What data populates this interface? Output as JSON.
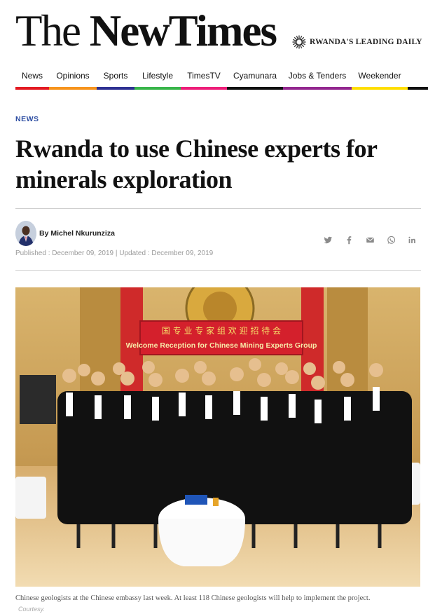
{
  "masthead": {
    "logo_word1": "The",
    "logo_word2": "New",
    "logo_word3": "Times",
    "tagline": "RWANDA'S LEADING DAILY"
  },
  "nav": {
    "items": [
      {
        "label": "News",
        "color": "#e31b23"
      },
      {
        "label": "Opinions",
        "color": "#f7941d"
      },
      {
        "label": "Sports",
        "color": "#2e3192"
      },
      {
        "label": "Lifestyle",
        "color": "#39b54a"
      },
      {
        "label": "TimesTV",
        "color": "#ed1e79"
      },
      {
        "label": "Cyamunara",
        "color": "#111111"
      },
      {
        "label": "Jobs & Tenders",
        "color": "#93278f"
      },
      {
        "label": "Weekender",
        "color": "#ffde00"
      }
    ],
    "trailing_color": "#111111"
  },
  "article": {
    "category": "NEWS",
    "title": "Rwanda to use Chinese experts for minerals exploration",
    "author": "By Michel Nkurunziza",
    "dates": "Published : December 09, 2019 | Updated : December 09, 2019",
    "banner_text": "Welcome Reception for Chinese Mining Experts Group",
    "caption": "Chinese geologists at the Chinese embassy last week. At least 118 Chinese geologists will help to implement the project.",
    "credit": "Courtesy."
  },
  "share": {
    "icons": [
      "twitter-icon",
      "facebook-icon",
      "email-icon",
      "whatsapp-icon",
      "linkedin-icon"
    ]
  },
  "colors": {
    "category_blue": "#2f4fa3",
    "banner_red": "#d4202c",
    "gold_wall": "#c9a15a"
  }
}
